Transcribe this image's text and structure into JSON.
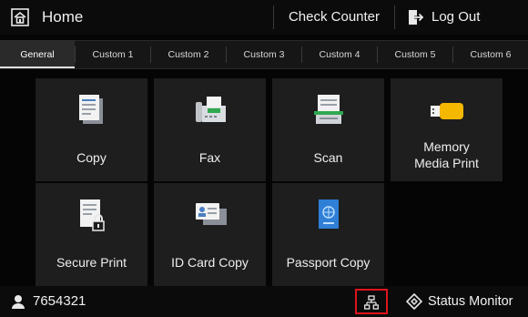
{
  "header": {
    "home_label": "Home",
    "check_counter_label": "Check Counter",
    "logout_label": "Log Out"
  },
  "tabs": [
    {
      "label": "General",
      "active": true
    },
    {
      "label": "Custom 1",
      "active": false
    },
    {
      "label": "Custom 2",
      "active": false
    },
    {
      "label": "Custom 3",
      "active": false
    },
    {
      "label": "Custom 4",
      "active": false
    },
    {
      "label": "Custom 5",
      "active": false
    },
    {
      "label": "Custom 6",
      "active": false
    }
  ],
  "functions": [
    {
      "label": "Copy",
      "icon": "copy-icon"
    },
    {
      "label": "Fax",
      "icon": "fax-icon"
    },
    {
      "label": "Scan",
      "icon": "scan-icon"
    },
    {
      "label_line1": "Memory",
      "label_line2": "Media Print",
      "icon": "usb-memory-icon"
    },
    {
      "label": "Secure Print",
      "icon": "secure-print-icon"
    },
    {
      "label": "ID Card Copy",
      "icon": "id-card-copy-icon"
    },
    {
      "label": "Passport Copy",
      "icon": "passport-copy-icon"
    }
  ],
  "footer": {
    "user_id": "7654321",
    "status_monitor_label": "Status Monitor"
  },
  "colors": {
    "accent_green": "#2fa84f",
    "usb_yellow": "#f5b800",
    "highlight_red": "#e0141b",
    "passport_blue": "#2f7fd6"
  }
}
